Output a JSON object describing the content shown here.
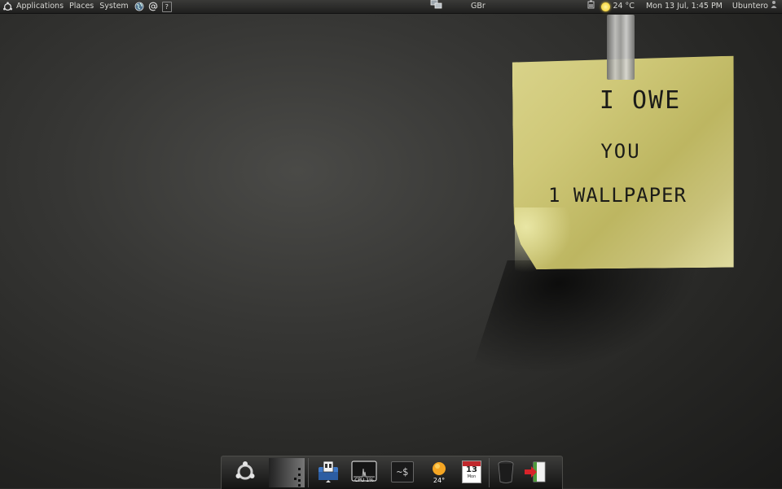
{
  "top_panel": {
    "menus": [
      "Applications",
      "Places",
      "System"
    ],
    "help_glyph": "?",
    "launchers": [
      "globe-icon",
      "email-at-icon",
      "help-icon"
    ],
    "keyboard_layout": "GBr",
    "weather": {
      "temperature": "24 °C",
      "icon": "sun-icon"
    },
    "clock": "Mon 13 Jul,  1:45 PM",
    "username": "Ubuntero"
  },
  "sticky_note": {
    "lines": [
      "I OWE",
      "YOU",
      "1 WALLPAPER"
    ],
    "color": "#cfc878"
  },
  "dock": {
    "items": [
      {
        "name": "ubuntu-logo-icon"
      },
      {
        "name": "workspace-switcher-icon"
      },
      {
        "name": "file-manager-icon"
      },
      {
        "name": "cpu-monitor-icon",
        "label": "CPU 1%"
      },
      {
        "name": "terminal-icon",
        "label": "~$"
      },
      {
        "name": "weather-dock-icon",
        "label": "24°"
      },
      {
        "name": "calendar-icon",
        "day": "13",
        "weekday": "Mon"
      },
      {
        "name": "trash-icon"
      },
      {
        "name": "logout-icon"
      }
    ]
  }
}
